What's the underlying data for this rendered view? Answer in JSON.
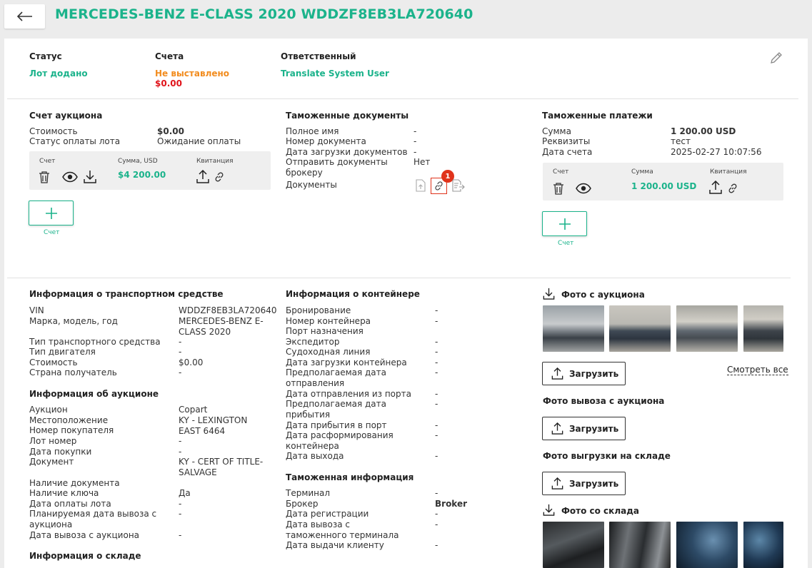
{
  "header": {
    "title": "MERCEDES-BENZ E-CLASS 2020 WDDZF8EB3LA720640"
  },
  "status_bar": {
    "status_label": "Статус",
    "status_value": "Лот додано",
    "invoices_label": "Счета",
    "invoices_value": "Не выставлено",
    "invoices_amount": "$0.00",
    "responsible_label": "Ответственный",
    "responsible_value": "Translate System User"
  },
  "auction_invoice": {
    "title": "Счет аукциона",
    "rows": [
      {
        "label": "Стоимость",
        "value": "$0.00"
      },
      {
        "label": "Статус оплаты лота",
        "value": "Ожидание оплаты"
      }
    ],
    "panel": {
      "col1": "Счет",
      "col2": "Сумма, USD",
      "col3": "Квитанция",
      "amount": "$4 200.00"
    },
    "add_caption": "Счет"
  },
  "customs_docs": {
    "title": "Таможенные документы",
    "rows": [
      {
        "label": "Полное имя",
        "value": "-"
      },
      {
        "label": "Номер документа",
        "value": "-"
      },
      {
        "label": "Дата загрузки документов",
        "value": "-"
      },
      {
        "label": "Отправить документы брокеру",
        "value": "Нет"
      },
      {
        "label": "Документы",
        "value": ""
      }
    ],
    "badge": "1"
  },
  "customs_payments": {
    "title": "Таможенные платежи",
    "rows": [
      {
        "label": "Сумма",
        "value": "1 200.00 USD"
      },
      {
        "label": "Реквизиты",
        "value": "тест"
      },
      {
        "label": "Дата счета",
        "value": "2025-02-27 10:07:56"
      }
    ],
    "panel": {
      "col1": "Счет",
      "col2": "Сумма",
      "col3": "Квитанция",
      "amount": "1 200.00 USD"
    },
    "add_caption": "Счет"
  },
  "vehicle_info": {
    "title": "Информация о транспортном средстве",
    "rows": [
      {
        "label": "VIN",
        "value": "WDDZF8EB3LA720640"
      },
      {
        "label": "Марка, модель, год",
        "value": "MERCEDES-BENZ E-CLASS 2020"
      },
      {
        "label": "Тип транспортного средства",
        "value": "-"
      },
      {
        "label": "Тип двигателя",
        "value": "-"
      },
      {
        "label": "Стоимость",
        "value": "$0.00"
      },
      {
        "label": "Страна получатель",
        "value": "-"
      }
    ]
  },
  "auction_info": {
    "title": "Информация об аукционе",
    "rows": [
      {
        "label": "Аукцион",
        "value": "Copart"
      },
      {
        "label": "Местоположение",
        "value": "KY - LEXINGTON EAST 6464"
      },
      {
        "label": "Номер покупателя",
        "value": "-"
      },
      {
        "label": "Лот номер",
        "value": "-"
      },
      {
        "label": "Дата покупки",
        "value": "-"
      },
      {
        "label": "Документ",
        "value": "KY - CERT OF TITLE-SALVAGE"
      },
      {
        "label": "Наличие документа",
        "value": ""
      },
      {
        "label": "Наличие ключа",
        "value": "Да"
      },
      {
        "label": "Дата оплаты лота",
        "value": "-"
      },
      {
        "label": "Планируемая дата вывоза с аукциона",
        "value": "-"
      },
      {
        "label": "Дата вывоза с аукциона",
        "value": "-"
      }
    ]
  },
  "warehouse_info": {
    "title": "Информация о складе"
  },
  "container_info": {
    "title": "Информация о контейнере",
    "rows": [
      {
        "label": "Бронирование",
        "value": "-"
      },
      {
        "label": "Номер контейнера",
        "value": "-"
      },
      {
        "label": "Порт назначения",
        "value": ""
      },
      {
        "label": "Экспедитор",
        "value": "-"
      },
      {
        "label": "Судоходная линия",
        "value": "-"
      },
      {
        "label": "Дата загрузки контейнера",
        "value": "-"
      },
      {
        "label": "Предполагаемая дата отправления",
        "value": "-"
      },
      {
        "label": "Дата отправления из порта",
        "value": "-"
      },
      {
        "label": "Предполагаемая дата прибытия",
        "value": "-"
      },
      {
        "label": "Дата прибытия в порт",
        "value": "-"
      },
      {
        "label": "Дата расформирования контейнера",
        "value": "-"
      },
      {
        "label": "Дата выхода",
        "value": "-"
      }
    ]
  },
  "customs_info": {
    "title": "Таможенная информация",
    "rows": [
      {
        "label": "Терминал",
        "value": "-"
      },
      {
        "label": "Брокер",
        "value": "Broker"
      },
      {
        "label": "Дата регистрации",
        "value": "-"
      },
      {
        "label": "Дата вывоза с таможенного терминала",
        "value": "-"
      },
      {
        "label": "Дата выдачи клиенту",
        "value": "-"
      }
    ]
  },
  "photos": {
    "auction_title": "Фото с аукциона",
    "upload_label": "Загрузить",
    "see_all": "Смотреть все",
    "pickup_title": "Фото вывоза с аукциона",
    "unload_title": "Фото выгрузки на складе",
    "warehouse_title": "Фото со склада"
  },
  "colors": {
    "accent": "#1bb38b",
    "warning": "#f28c1e",
    "error": "#e0141b",
    "link": "#1a7cc9"
  },
  "icons": [
    "arrow-left-icon",
    "pencil-icon",
    "trash-icon",
    "eye-icon",
    "download-icon",
    "upload-icon",
    "link-icon",
    "plus-icon",
    "file-upload-icon",
    "file-send-icon"
  ]
}
